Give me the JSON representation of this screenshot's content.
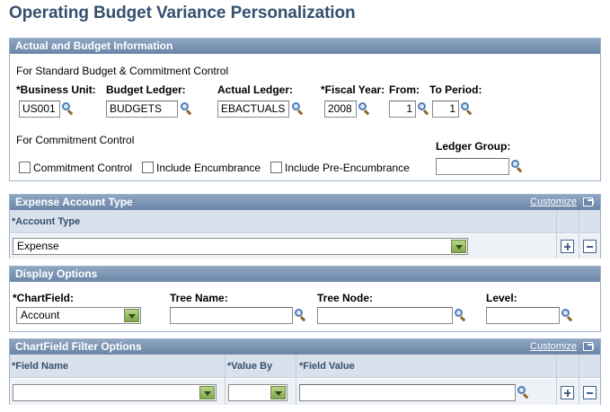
{
  "page": {
    "title": "Operating Budget Variance Personalization"
  },
  "actual_budget": {
    "header": "Actual and Budget Information",
    "std_note": "For Standard Budget & Commitment Control",
    "business_unit_label": "*Business Unit:",
    "business_unit_value": "US001",
    "budget_ledger_label": "Budget Ledger:",
    "budget_ledger_value": "BUDGETS",
    "actual_ledger_label": "Actual Ledger:",
    "actual_ledger_value": "EBACTUALS",
    "fiscal_year_label": "*Fiscal Year:",
    "fiscal_year_value": "2008",
    "from_label": "From:",
    "from_value": "1",
    "to_period_label": "To Period:",
    "to_period_value": "1",
    "cc_note": "For Commitment Control",
    "ledger_group_label": "Ledger Group:",
    "ledger_group_value": "",
    "commitment_control_label": "Commitment Control",
    "include_encumbrance_label": "Include Encumbrance",
    "include_pre_encumbrance_label": "Include Pre-Encumbrance"
  },
  "expense_account": {
    "header": "Expense Account Type",
    "customize": "Customize",
    "account_type_label": "*Account Type",
    "account_type_value": "Expense"
  },
  "display_options": {
    "header": "Display Options",
    "chartfield_label": "*ChartField:",
    "chartfield_value": "Account",
    "tree_name_label": "Tree Name:",
    "tree_name_value": "",
    "tree_node_label": "Tree Node:",
    "tree_node_value": "",
    "level_label": "Level:",
    "level_value": ""
  },
  "filter_options": {
    "header": "ChartField Filter Options",
    "customize": "Customize",
    "field_name_label": "*Field Name",
    "value_by_label": "*Value By",
    "field_value_label": "*Field Value",
    "field_name_value": "",
    "value_by_value": "",
    "field_value_value": ""
  },
  "icons": {
    "lookup": "magnifier-lookup-icon",
    "dropdown": "dropdown-arrow-icon",
    "add": "add-row-icon",
    "delete": "delete-row-icon",
    "popup": "new-window-icon"
  }
}
